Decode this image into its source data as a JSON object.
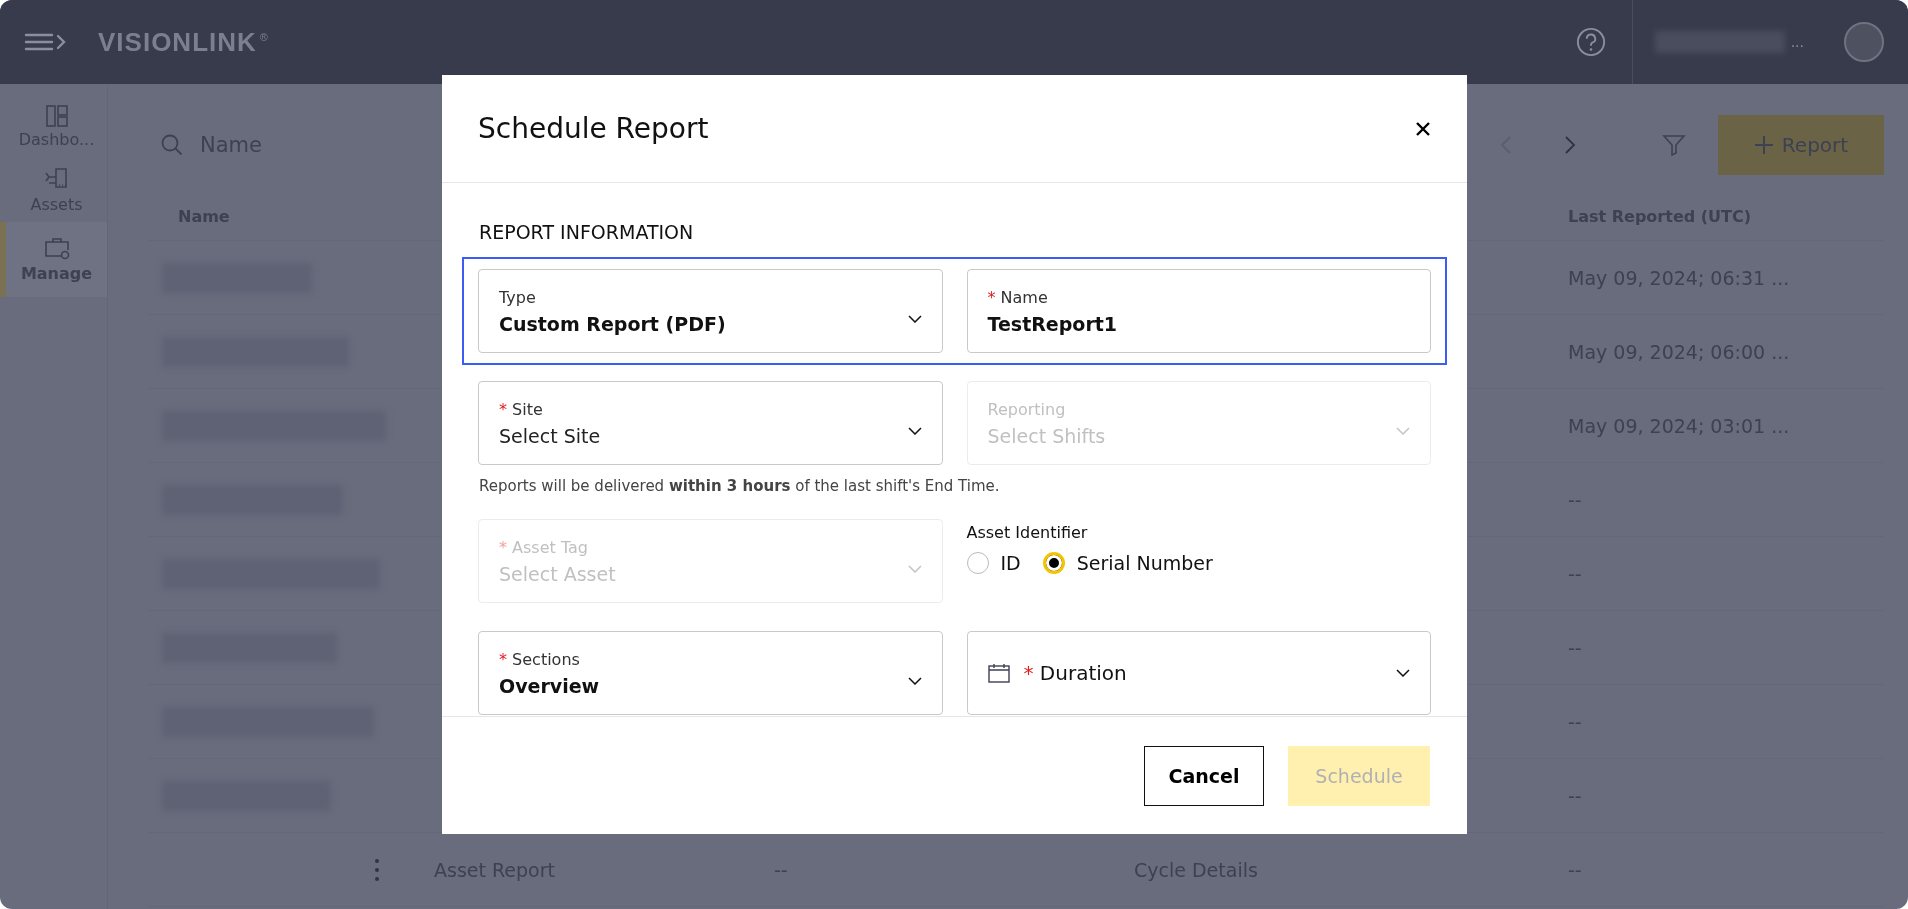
{
  "top_bar": {
    "logo": "VISIONLINK",
    "logo_mark": "®",
    "user_suffix": "..."
  },
  "sidebar": {
    "items": [
      {
        "label": "Dashbo...",
        "selected": false
      },
      {
        "label": "Assets",
        "selected": false
      },
      {
        "label": "Manage",
        "selected": true
      }
    ]
  },
  "search": {
    "placeholder": "Name"
  },
  "toolbar": {
    "report_button": "Report"
  },
  "table": {
    "columns": [
      {
        "label": "Name"
      },
      {
        "label": "Last Reported (UTC)"
      }
    ],
    "rows": [
      {
        "last_reported": "May 09, 2024; 06:31 ..."
      },
      {
        "last_reported": "May 09, 2024; 06:00 ..."
      },
      {
        "last_reported": "May 09, 2024; 03:01 ..."
      },
      {
        "last_reported": "--"
      },
      {
        "last_reported": "--"
      },
      {
        "last_reported": "--"
      },
      {
        "last_reported": "--"
      },
      {
        "last_reported": "--"
      },
      {
        "name": "Asset Report",
        "column_3": "--",
        "column_4": "Cycle Details",
        "last_reported": "--"
      }
    ]
  },
  "modal": {
    "title": "Schedule Report",
    "section": "REPORT INFORMATION",
    "rows": [
      {
        "highlighted": true,
        "items": [
          {
            "kind": "select",
            "label": "Type",
            "value": "Custom Report (PDF)"
          },
          {
            "kind": "input",
            "required_mark": "*",
            "label": "Name",
            "value": "TestReport1"
          }
        ]
      },
      {
        "note": "Reports will be delivered **within 3 hours** of the last shift's End Time.",
        "items": [
          {
            "kind": "select",
            "required_mark": "*",
            "label": "Site",
            "placeholder": "Select Site"
          },
          {
            "kind": "select",
            "label": "Reporting",
            "disabled": true,
            "placeholder": "Select Shifts"
          }
        ]
      },
      {
        "items": [
          {
            "kind": "select",
            "required_mark": "*",
            "label": "Asset Tag",
            "disabled": true,
            "placeholder": "Select Asset"
          },
          {
            "kind": "radio_group",
            "label": "Asset Identifier",
            "options": [
              {
                "label": "ID",
                "selected": false
              },
              {
                "label": "Serial Number",
                "selected": true
              }
            ]
          }
        ]
      },
      {
        "items": [
          {
            "kind": "select",
            "required_mark": "*",
            "label": "Sections",
            "value": "Overview"
          },
          {
            "kind": "date",
            "required_mark": "*",
            "label": "Duration"
          }
        ]
      }
    ],
    "buttons": [
      {
        "label": "Cancel",
        "kind": "secondary",
        "disabled": false
      },
      {
        "label": "Schedule",
        "kind": "primary",
        "disabled": true
      }
    ]
  }
}
